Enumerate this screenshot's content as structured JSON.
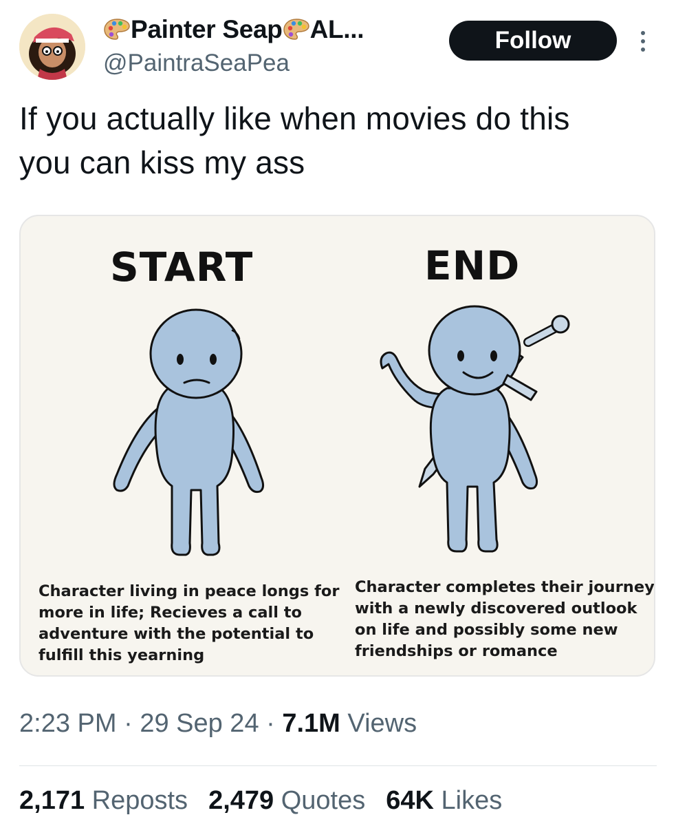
{
  "header": {
    "display_name": "Painter Seap",
    "display_name_suffix": "AL...",
    "handle": "@PaintraSeaPea",
    "follow_label": "Follow",
    "name_icon": "artist-palette-emoji",
    "more_icon": "vertical-ellipsis-icon"
  },
  "tweet": {
    "text_line_1": "If you actually like when movies do this",
    "text_line_2": "you can kiss my ass"
  },
  "media": {
    "start": {
      "title": "START",
      "caption_lines": [
        "Character living in peace longs for",
        "more in life; Recieves a call to",
        "adventure with the potential to",
        "fulfill this yearning"
      ]
    },
    "end": {
      "title": "END",
      "caption_lines": [
        "Character completes their journey",
        "with a newly discovered outlook",
        "on life and possibly some new",
        "friendships or romance"
      ]
    },
    "figure_color": "#a9c3dd"
  },
  "meta": {
    "time": "2:23 PM",
    "separator": "·",
    "date": "29 Sep 24",
    "views_count": "7.1M",
    "views_label": "Views"
  },
  "stats": {
    "reposts_count": "2,171",
    "reposts_label": "Reposts",
    "quotes_count": "2,479",
    "quotes_label": "Quotes",
    "likes_count": "64K",
    "likes_label": "Likes"
  }
}
